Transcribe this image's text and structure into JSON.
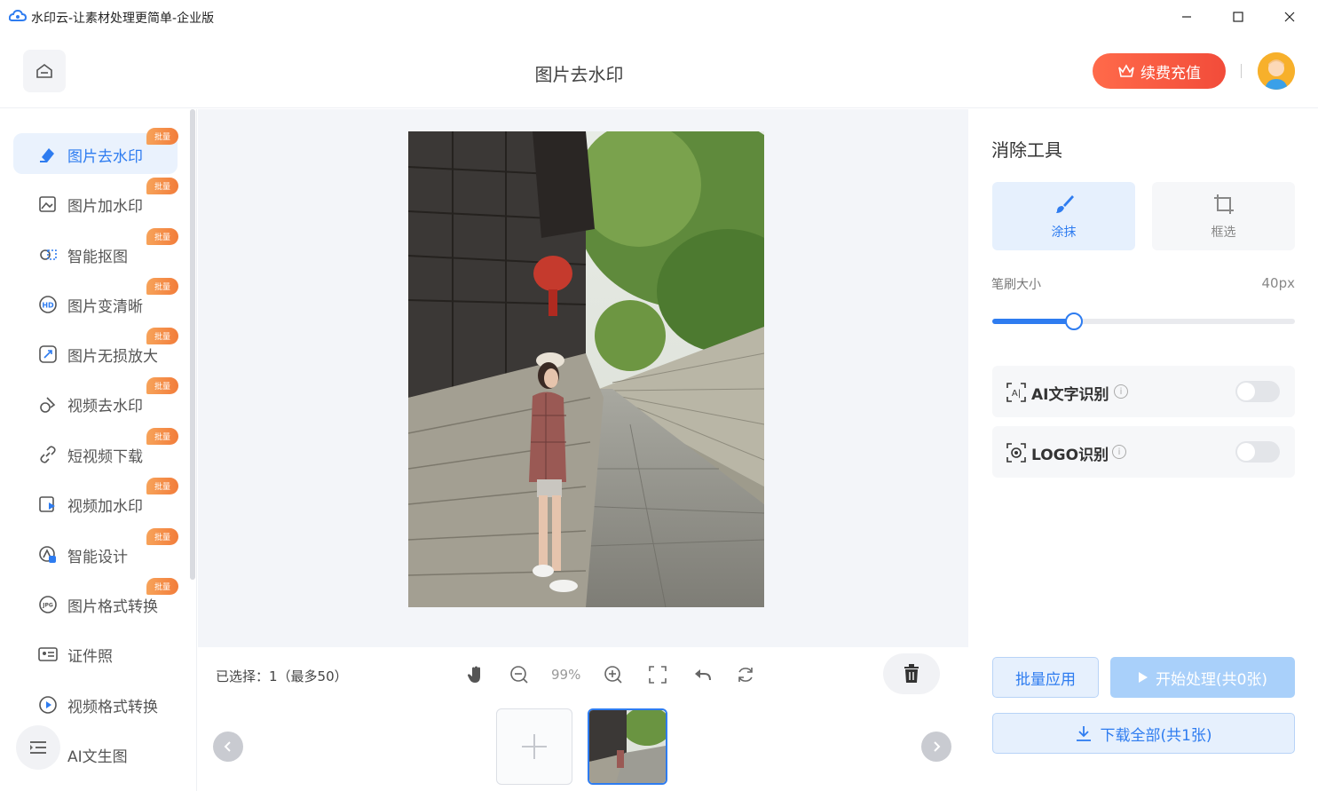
{
  "window": {
    "title": "水印云-让素材处理更简单-企业版",
    "controls": [
      "minimize-icon",
      "maximize-icon",
      "close-icon"
    ]
  },
  "header": {
    "page_title": "图片去水印",
    "vip_button": "续费充值"
  },
  "sidebar": {
    "items": [
      {
        "label": "图片去水印",
        "badge": "批量",
        "icon": "eraser-icon",
        "active": true
      },
      {
        "label": "图片加水印",
        "badge": "批量",
        "icon": "image-add-icon"
      },
      {
        "label": "智能抠图",
        "badge": "批量",
        "icon": "cutout-icon"
      },
      {
        "label": "图片变清晰",
        "badge": "批量",
        "icon": "hd-icon"
      },
      {
        "label": "图片无损放大",
        "badge": "批量",
        "icon": "enlarge-icon"
      },
      {
        "label": "视频去水印",
        "badge": "批量",
        "icon": "video-eraser-icon"
      },
      {
        "label": "短视频下载",
        "badge": "批量",
        "icon": "link-icon"
      },
      {
        "label": "视频加水印",
        "badge": "批量",
        "icon": "video-add-icon"
      },
      {
        "label": "智能设计",
        "badge": "批量",
        "icon": "design-icon"
      },
      {
        "label": "图片格式转换",
        "badge": "批量",
        "icon": "jpg-icon"
      },
      {
        "label": "证件照",
        "badge": "",
        "icon": "id-card-icon"
      },
      {
        "label": "视频格式转换",
        "badge": "",
        "icon": "play-circle-icon"
      },
      {
        "label": "AI文生图",
        "badge": "",
        "icon": "ai-image-icon"
      }
    ]
  },
  "toolbar": {
    "selection_text": "已选择：1（最多50）",
    "zoom": "99%",
    "icons": [
      "hand-icon",
      "zoom-out-icon",
      "zoom-in-icon",
      "fit-screen-icon",
      "undo-icon",
      "reset-icon",
      "trash-icon"
    ]
  },
  "right_panel": {
    "title": "消除工具",
    "tools": [
      {
        "label": "涂抹",
        "active": true
      },
      {
        "label": "框选",
        "active": false
      }
    ],
    "brush_label": "笔刷大小",
    "brush_value": "40px",
    "brush_fraction": 0.27,
    "toggles": [
      {
        "label": "AI文字识别",
        "on": false
      },
      {
        "label": "LOGO识别",
        "on": false
      }
    ],
    "batch_button": "批量应用",
    "start_button": "开始处理(共0张)",
    "download_button": "下载全部(共1张)"
  },
  "colors": {
    "accent": "#2e7cf0",
    "vip": "#f24c3a",
    "badge": "#f27c3a"
  }
}
